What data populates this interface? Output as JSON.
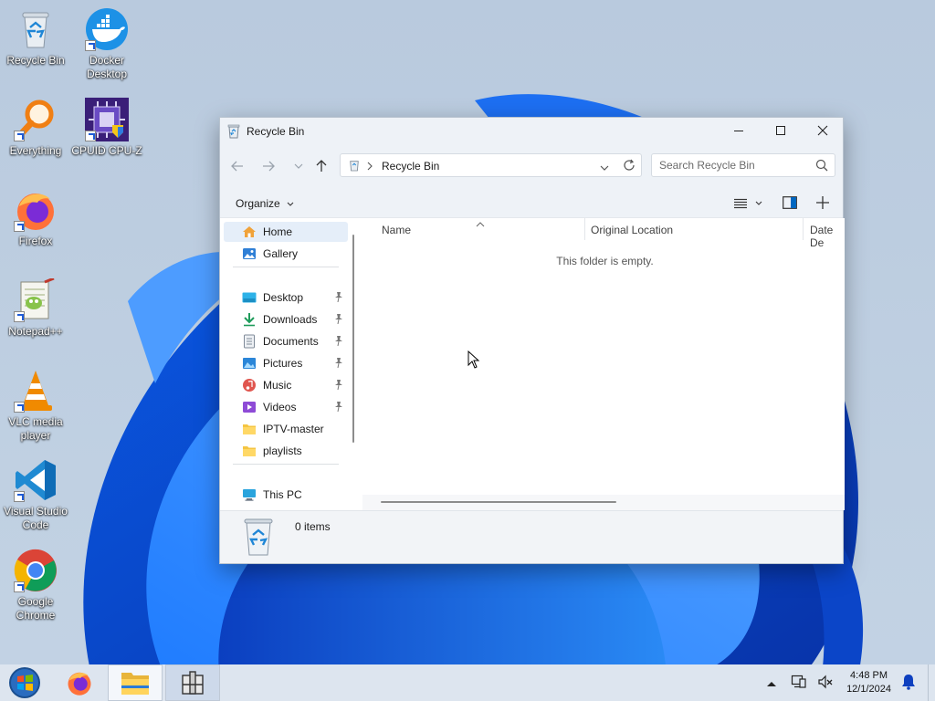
{
  "desktop": {
    "icons": [
      {
        "name": "recycle-bin",
        "label": "Recycle Bin"
      },
      {
        "name": "docker-desktop",
        "label": "Docker Desktop"
      },
      {
        "name": "everything",
        "label": "Everything"
      },
      {
        "name": "cpu-z",
        "label": "CPUID CPU-Z"
      },
      {
        "name": "firefox",
        "label": "Firefox"
      },
      {
        "name": "notepad-plus-plus",
        "label": "Notepad++"
      },
      {
        "name": "vlc",
        "label": "VLC media player"
      },
      {
        "name": "vscode",
        "label": "Visual Studio Code"
      },
      {
        "name": "chrome",
        "label": "Google Chrome"
      }
    ]
  },
  "window": {
    "title": "Recycle Bin",
    "address": {
      "path": "Recycle Bin"
    },
    "search": {
      "placeholder": "Search Recycle Bin"
    },
    "command": {
      "organize": "Organize"
    },
    "nav": {
      "items": [
        {
          "label": "Home",
          "icon": "home-icon",
          "selected": true
        },
        {
          "label": "Gallery",
          "icon": "gallery-icon"
        },
        {
          "label": "Desktop",
          "icon": "desktop-folder-icon",
          "pinned": true
        },
        {
          "label": "Downloads",
          "icon": "download-icon",
          "pinned": true
        },
        {
          "label": "Documents",
          "icon": "document-icon",
          "pinned": true
        },
        {
          "label": "Pictures",
          "icon": "pictures-icon",
          "pinned": true
        },
        {
          "label": "Music",
          "icon": "music-icon",
          "pinned": true
        },
        {
          "label": "Videos",
          "icon": "video-icon",
          "pinned": true
        },
        {
          "label": "IPTV-master",
          "icon": "folder-icon"
        },
        {
          "label": "playlists",
          "icon": "folder-icon"
        },
        {
          "label": "This PC",
          "icon": "pc-icon"
        }
      ]
    },
    "columns": [
      "Name",
      "Original Location",
      "Date De"
    ],
    "empty_message": "This folder is empty.",
    "status": {
      "items": "0 items"
    }
  },
  "taskbar": {
    "time": "4:48 PM",
    "date": "12/1/2024"
  },
  "colors": {
    "accent": "#0067c0",
    "window_chrome": "#eef2f7",
    "taskbar": "#dde5ef"
  }
}
